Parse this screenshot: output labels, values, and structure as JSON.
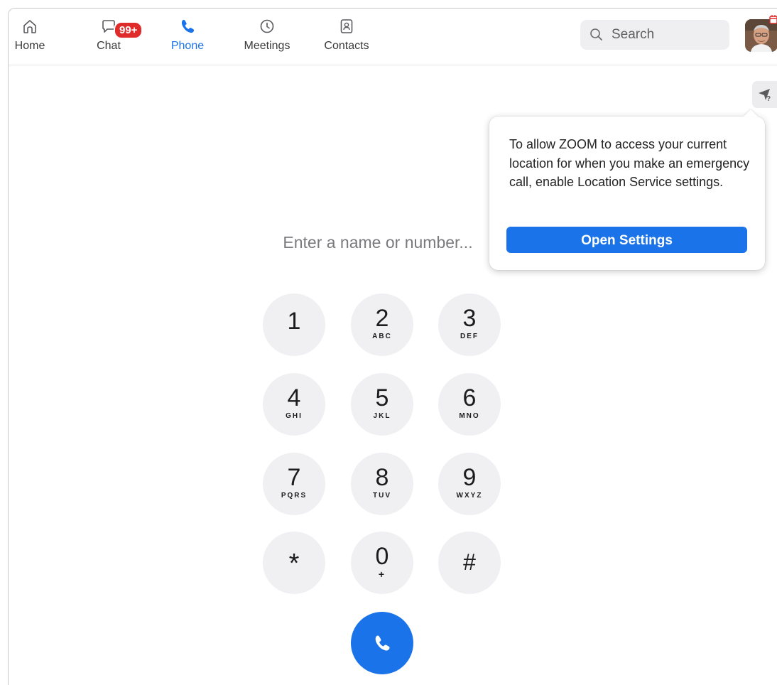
{
  "nav": {
    "items": [
      {
        "label": "Home",
        "icon": "home-icon"
      },
      {
        "label": "Chat",
        "icon": "chat-icon",
        "badge": "99+"
      },
      {
        "label": "Phone",
        "icon": "phone-icon",
        "active": true
      },
      {
        "label": "Meetings",
        "icon": "clock-icon"
      },
      {
        "label": "Contacts",
        "icon": "contacts-icon"
      }
    ],
    "search_placeholder": "Search"
  },
  "popover": {
    "message": "To allow ZOOM to access your current location for when you make an emergency call, enable Location Service settings.",
    "button_label": "Open Settings"
  },
  "dialer": {
    "placeholder": "Enter a name or number...",
    "keys": [
      {
        "digit": "1",
        "letters": ""
      },
      {
        "digit": "2",
        "letters": "ABC"
      },
      {
        "digit": "3",
        "letters": "DEF"
      },
      {
        "digit": "4",
        "letters": "GHI"
      },
      {
        "digit": "5",
        "letters": "JKL"
      },
      {
        "digit": "6",
        "letters": "MNO"
      },
      {
        "digit": "7",
        "letters": "PQRS"
      },
      {
        "digit": "8",
        "letters": "TUV"
      },
      {
        "digit": "9",
        "letters": "WXYZ"
      },
      {
        "digit": "*",
        "letters": ""
      },
      {
        "digit": "0",
        "letters": "+"
      },
      {
        "digit": "#",
        "letters": ""
      }
    ]
  },
  "colors": {
    "accent": "#1a73e8",
    "badge": "#e02b2b",
    "key_bg": "#f0f0f3"
  }
}
